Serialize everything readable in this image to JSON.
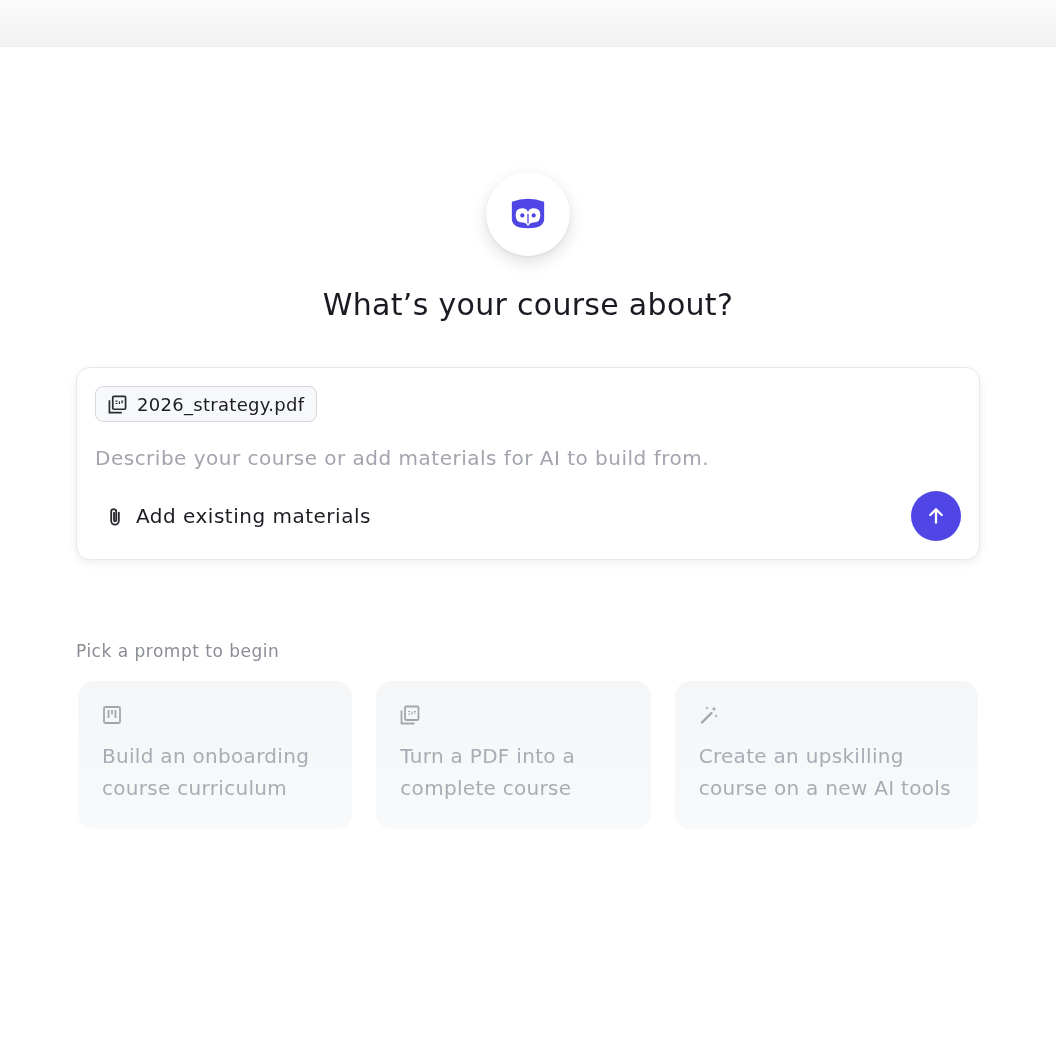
{
  "heading": "What’s your course about?",
  "composer": {
    "attachments": [
      {
        "name": "2026_strategy.pdf"
      }
    ],
    "placeholder": "Describe your course or add materials for AI to build from.",
    "add_button": "Add existing materials"
  },
  "prompts": {
    "label": "Pick a prompt to begin",
    "items": [
      {
        "text": "Build an onboarding course curriculum"
      },
      {
        "text": "Turn a PDF into a complete course"
      },
      {
        "text": "Create an upskilling course on a new AI tools"
      }
    ]
  }
}
